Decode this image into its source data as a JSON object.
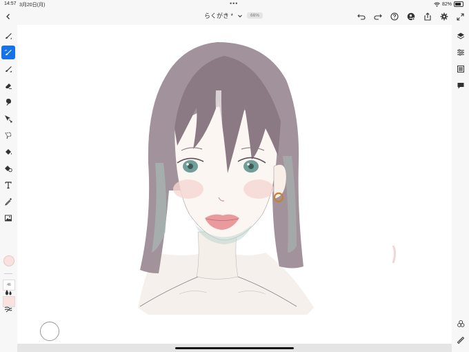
{
  "status_bar": {
    "time": "14:57",
    "date": "3月20日(月)",
    "battery_text": "82%",
    "battery_level": 0.82
  },
  "header": {
    "document_title": "らくがき *",
    "zoom_level": "66%"
  },
  "tool_panel": {
    "brush_size": "46",
    "active_tool": "brush-tool",
    "selected_color": "#f9e1df"
  },
  "colors": {
    "accent": "#1473e6",
    "canvas": "#ffffff",
    "hair": "#8e7d86",
    "lips": "#e99a9c",
    "eyes": "#6f9f98"
  }
}
